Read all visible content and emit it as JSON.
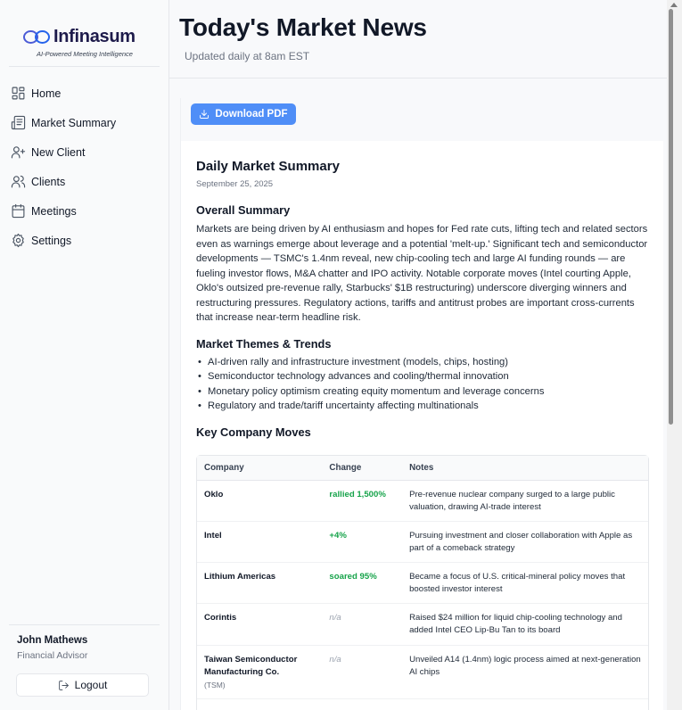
{
  "brand": {
    "name": "Infinasum",
    "tagline": "AI-Powered Meeting Intelligence"
  },
  "nav": [
    {
      "label": "Home",
      "icon": "home-grid-icon"
    },
    {
      "label": "Market Summary",
      "icon": "newspaper-icon"
    },
    {
      "label": "New Client",
      "icon": "user-plus-icon"
    },
    {
      "label": "Clients",
      "icon": "users-icon"
    },
    {
      "label": "Meetings",
      "icon": "calendar-icon"
    },
    {
      "label": "Settings",
      "icon": "gear-icon"
    }
  ],
  "user": {
    "name": "John Mathews",
    "role": "Financial Advisor",
    "logout_label": "Logout"
  },
  "header": {
    "title": "Today's Market News",
    "subtitle": "Updated daily at 8am EST"
  },
  "download_label": "Download PDF",
  "summary": {
    "title": "Daily Market Summary",
    "date": "September 25, 2025",
    "overall_heading": "Overall Summary",
    "overall_text": "Markets are being driven by AI enthusiasm and hopes for Fed rate cuts, lifting tech and related sectors even as warnings emerge about leverage and a potential 'melt-up.' Significant tech and semiconductor developments — TSMC's 1.4nm reveal, new chip-cooling tech and large AI funding rounds — are fueling investor flows, M&A chatter and IPO activity. Notable corporate moves (Intel courting Apple, Oklo's outsized pre-revenue rally, Starbucks' $1B restructuring) underscore diverging winners and restructuring pressures. Regulatory actions, tariffs and antitrust probes are important cross-currents that increase near-term headline risk.",
    "themes_heading": "Market Themes & Trends",
    "themes": [
      "AI-driven rally and infrastructure investment (models, chips, hosting)",
      "Semiconductor technology advances and cooling/thermal innovation",
      "Monetary policy optimism creating equity momentum and leverage concerns",
      "Regulatory and trade/tariff uncertainty affecting multinationals"
    ],
    "moves_heading": "Key Company Moves",
    "table_headers": [
      "Company",
      "Change",
      "Notes"
    ],
    "rows": [
      {
        "company": "Oklo",
        "ticker": "",
        "change": "rallied 1,500%",
        "positive": true,
        "notes": "Pre-revenue nuclear company surged to a large public valuation, drawing AI-trade interest"
      },
      {
        "company": "Intel",
        "ticker": "",
        "change": "+4%",
        "positive": true,
        "notes": "Pursuing investment and closer collaboration with Apple as part of a comeback strategy"
      },
      {
        "company": "Lithium Americas",
        "ticker": "",
        "change": "soared 95%",
        "positive": true,
        "notes": "Became a focus of U.S. critical-mineral policy moves that boosted investor interest"
      },
      {
        "company": "Corintis",
        "ticker": "",
        "change": "n/a",
        "positive": false,
        "notes": "Raised $24 million for liquid chip-cooling technology and added Intel CEO Lip-Bu Tan to its board"
      },
      {
        "company": "Taiwan Semiconductor Manufacturing Co.",
        "ticker": "(TSM)",
        "change": "n/a",
        "positive": false,
        "notes": "Unveiled A14 (1.4nm) logic process aimed at next-generation AI chips"
      }
    ]
  }
}
